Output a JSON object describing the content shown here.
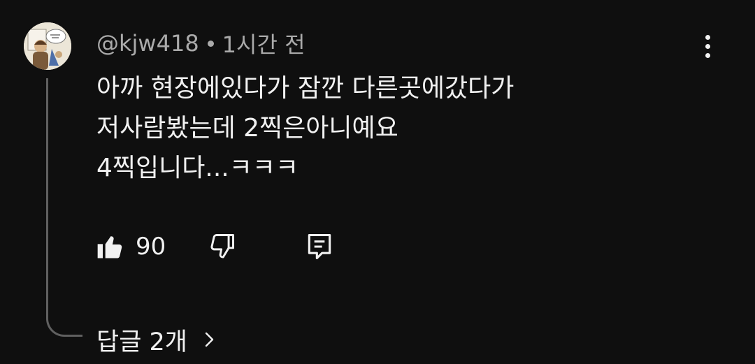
{
  "comment": {
    "author": "@kjw418",
    "time": "1시간 전",
    "text_lines": [
      "아까 현장에있다가 잠깐 다른곳에갔다가",
      "저사람봤는데 2찍은아니예요",
      "4찍입니다...ㅋㅋㅋ"
    ],
    "like_count": "90",
    "replies_label": "답글 2개"
  },
  "icons": {
    "avatar": "avatar-illustration",
    "more": "more-vertical-icon",
    "like": "thumbs-up-icon",
    "dislike": "thumbs-down-icon",
    "reply": "reply-comment-icon",
    "expand": "chevron-right-icon"
  },
  "colors": {
    "background": "#0f0f0f",
    "primary_text": "#f1f1f1",
    "secondary_text": "#aaaaaa",
    "thread_line": "#606060"
  }
}
